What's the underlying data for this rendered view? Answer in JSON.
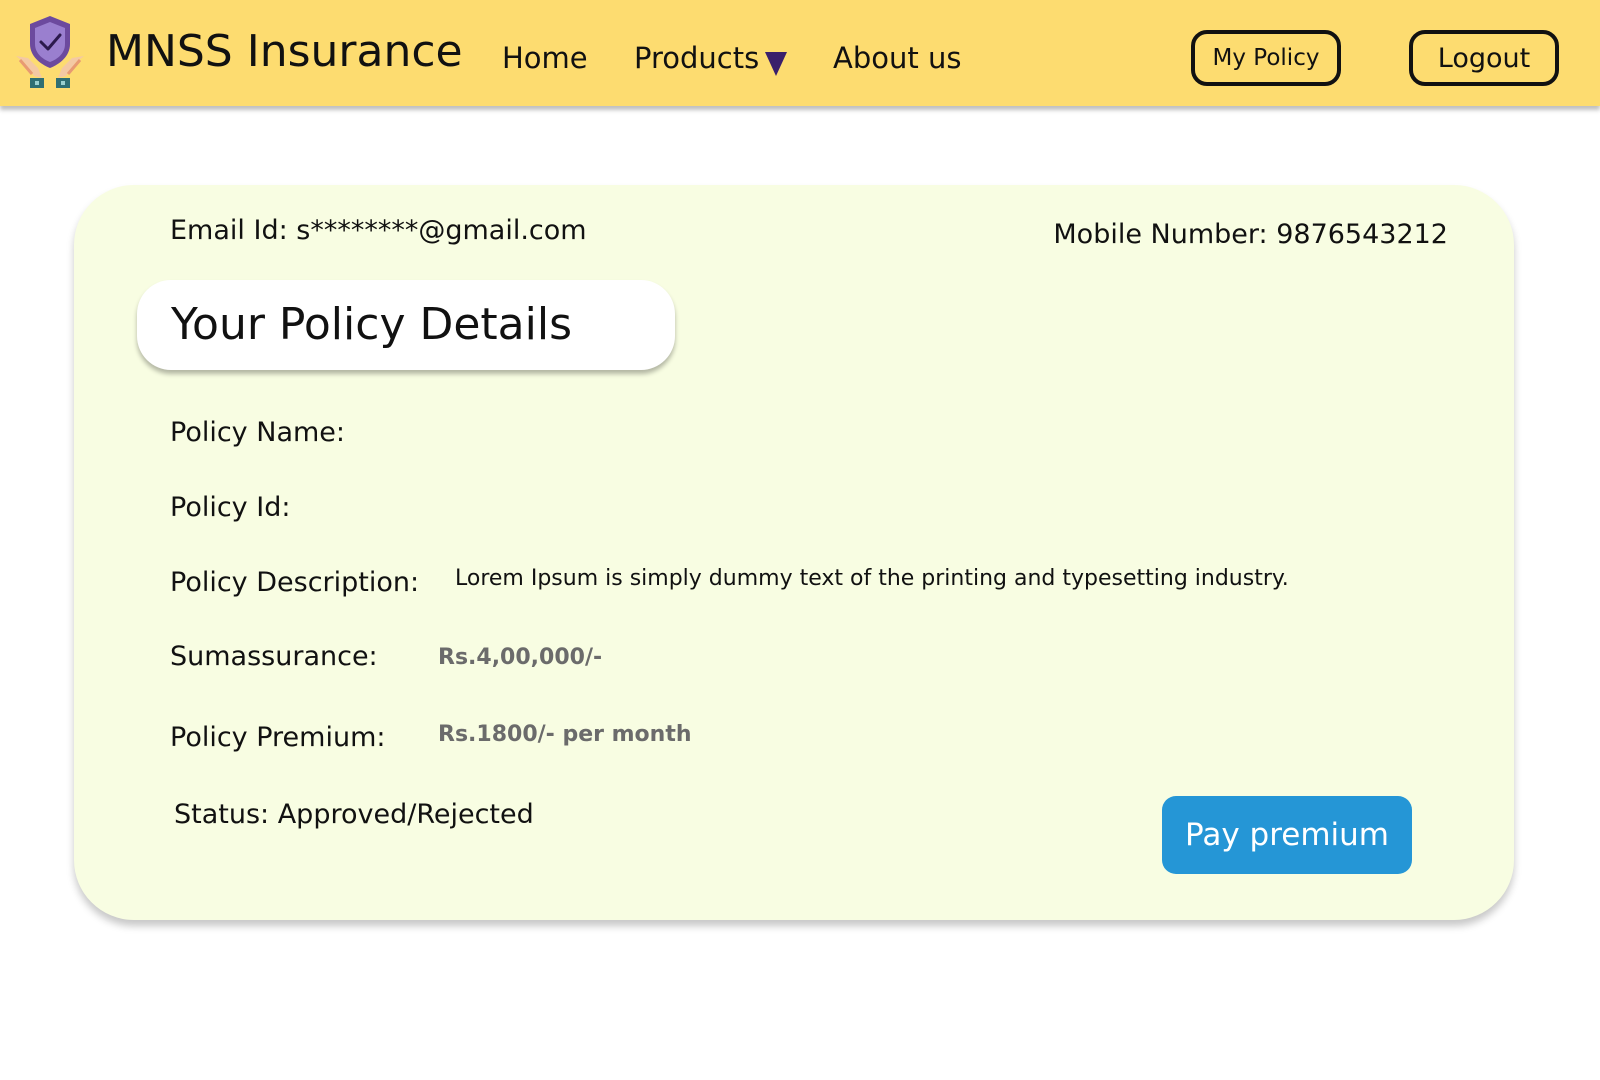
{
  "header": {
    "brand": "MNSS Insurance",
    "logo_icon": "shield-check-hands-icon",
    "nav": {
      "home": "Home",
      "products": "Products",
      "about": "About us"
    },
    "my_policy_label": "My Policy",
    "logout_label": "Logout",
    "bg_color": "#fddc70"
  },
  "card": {
    "email": "Email Id: s********@gmail.com",
    "mobile": "Mobile Number: 9876543212",
    "title": "Your Policy Details",
    "fields": {
      "policy_name_label": "Policy Name:",
      "policy_id_label": "Policy Id:",
      "policy_description_label": "Policy Description:",
      "policy_description_value": "Lorem Ipsum is simply dummy text of the printing and typesetting industry.",
      "sumassurance_label": "Sumassurance:",
      "sumassurance_value": "Rs.4,00,000/-",
      "policy_premium_label": "Policy Premium:",
      "policy_premium_value": "Rs.1800/- per month",
      "status": "Status: Approved/Rejected"
    },
    "pay_button_label": "Pay premium",
    "bg_color": "#f8fde2",
    "accent_color": "#2596d6"
  }
}
